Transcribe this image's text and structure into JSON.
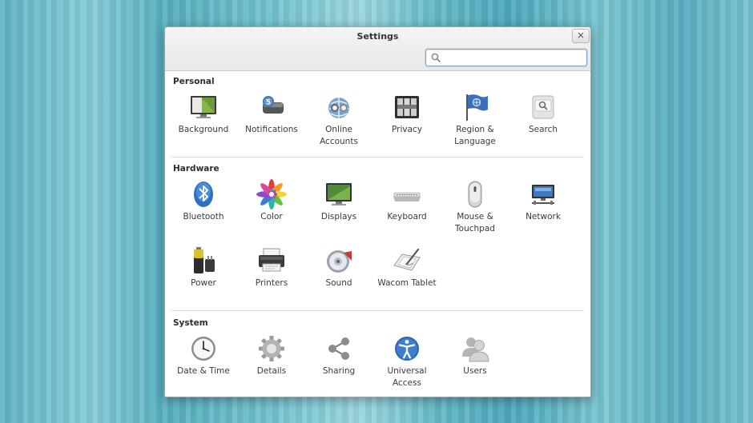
{
  "window": {
    "title": "Settings",
    "close_label": "×"
  },
  "search": {
    "value": "",
    "placeholder": ""
  },
  "sections": [
    {
      "title": "Personal",
      "items": [
        {
          "label": "Background",
          "icon": "background-icon"
        },
        {
          "label": "Notifications",
          "icon": "notifications-icon"
        },
        {
          "label": "Online\nAccounts",
          "icon": "online-accounts-icon"
        },
        {
          "label": "Privacy",
          "icon": "privacy-icon"
        },
        {
          "label": "Region &\nLanguage",
          "icon": "region-flag-icon"
        },
        {
          "label": "Search",
          "icon": "search-settings-icon"
        }
      ]
    },
    {
      "title": "Hardware",
      "items": [
        {
          "label": "Bluetooth",
          "icon": "bluetooth-icon"
        },
        {
          "label": "Color",
          "icon": "color-icon"
        },
        {
          "label": "Displays",
          "icon": "displays-icon"
        },
        {
          "label": "Keyboard",
          "icon": "keyboard-icon"
        },
        {
          "label": "Mouse &\nTouchpad",
          "icon": "mouse-icon"
        },
        {
          "label": "Network",
          "icon": "network-icon"
        },
        {
          "label": "Power",
          "icon": "power-icon"
        },
        {
          "label": "Printers",
          "icon": "printer-icon"
        },
        {
          "label": "Sound",
          "icon": "sound-icon"
        },
        {
          "label": "Wacom Tablet",
          "icon": "wacom-tablet-icon"
        }
      ]
    },
    {
      "title": "System",
      "items": [
        {
          "label": "Date & Time",
          "icon": "clock-icon"
        },
        {
          "label": "Details",
          "icon": "gear-icon"
        },
        {
          "label": "Sharing",
          "icon": "share-icon"
        },
        {
          "label": "Universal\nAccess",
          "icon": "universal-access-icon"
        },
        {
          "label": "Users",
          "icon": "users-icon"
        }
      ]
    }
  ],
  "colors": {
    "accent": "#3b7fc4",
    "search_border": "#7fa6c9"
  }
}
